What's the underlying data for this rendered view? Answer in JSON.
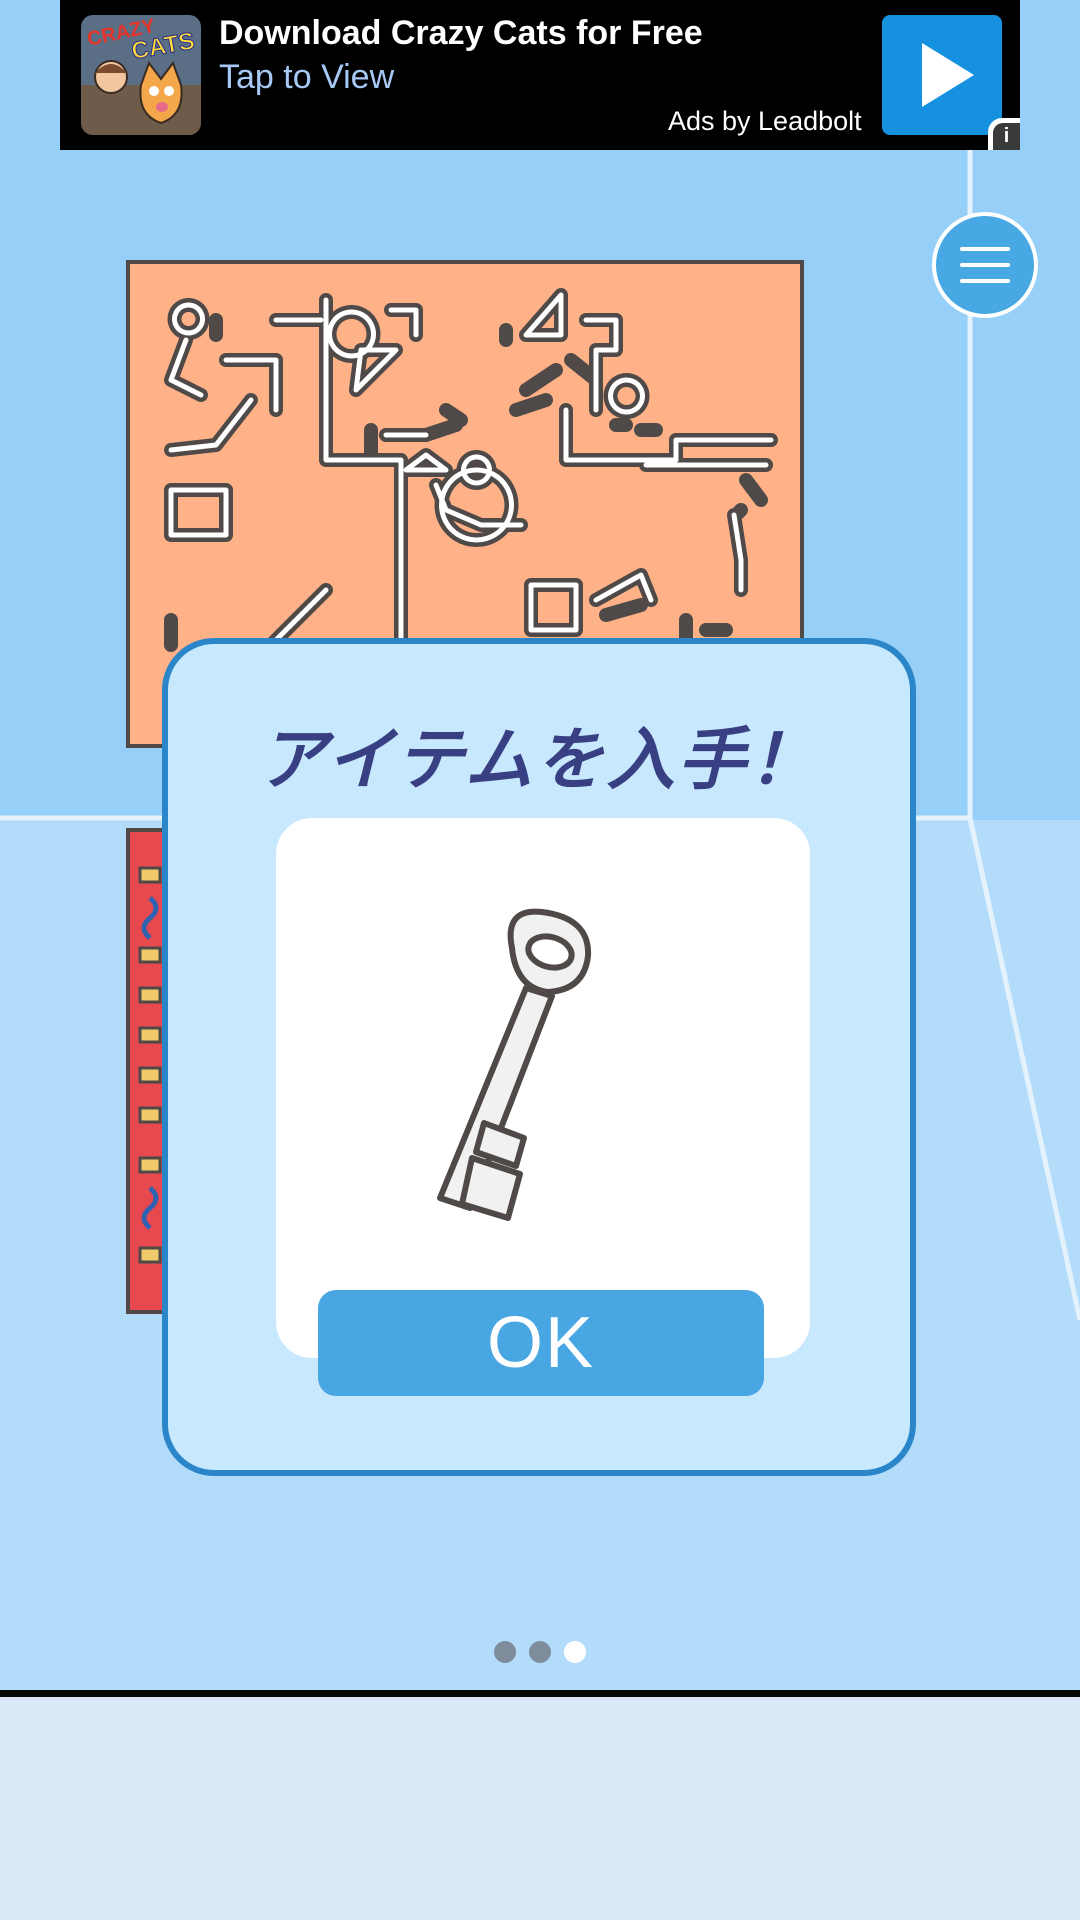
{
  "ad": {
    "title": "Download Crazy Cats for Free",
    "subtitle": "Tap to View",
    "attribution": "Ads by Leadbolt",
    "thumbnail_text_1": "CRAZY",
    "thumbnail_text_2": "CATS",
    "info_label": "i",
    "play_icon": "play-icon"
  },
  "menu": {
    "icon": "hamburger-menu-icon"
  },
  "modal": {
    "title": "アイテムを入手！",
    "item_icon": "key-icon",
    "ok_label": "OK"
  },
  "pagination": {
    "total": 3,
    "active_index": 2
  },
  "colors": {
    "wall": "#96cff7",
    "floor": "#b3dcfb",
    "modal_border": "#2a86c9",
    "modal_bg": "#c7e8fd",
    "button": "#48a6e2",
    "title_text": "#384083",
    "maze_painting": "#ffb187",
    "red_painting": "#e7494e"
  }
}
